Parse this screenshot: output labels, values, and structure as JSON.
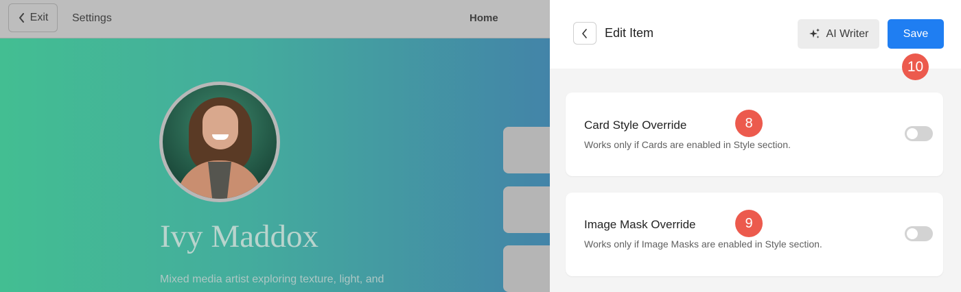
{
  "topbar": {
    "exit_label": "Exit",
    "settings_label": "Settings",
    "home_label": "Home"
  },
  "preview": {
    "name": "Ivy Maddox",
    "subtitle": "Mixed media artist exploring texture, light, and"
  },
  "panel": {
    "title": "Edit Item",
    "ai_writer_label": "AI Writer",
    "save_label": "Save",
    "save_badge": "10",
    "cards": [
      {
        "title": "Card Style Override",
        "description": "Works only if Cards are enabled in Style section.",
        "badge": "8",
        "enabled": false
      },
      {
        "title": "Image Mask Override",
        "description": "Works only if Image Masks are enabled in Style section.",
        "badge": "9",
        "enabled": false
      }
    ]
  },
  "colors": {
    "accent": "#1f7ef2",
    "badge": "#ec5a4d",
    "hero_start": "#43be92",
    "hero_end": "#4384a8"
  }
}
